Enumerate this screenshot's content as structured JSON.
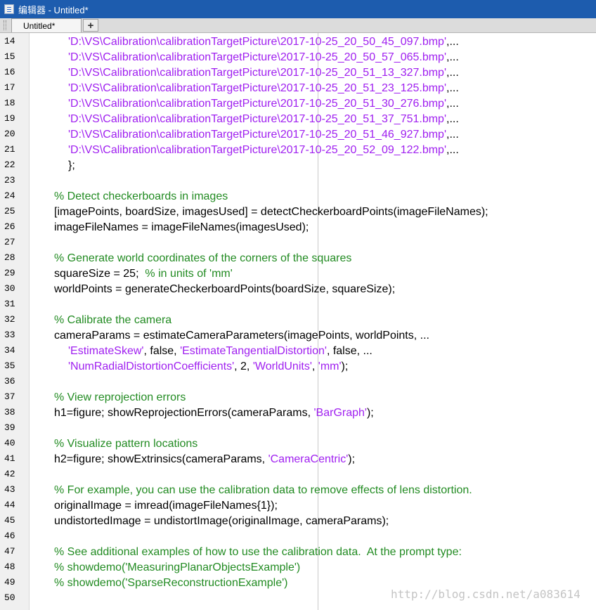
{
  "window": {
    "title": "编辑器 - Untitled*"
  },
  "tabs": [
    {
      "label": "Untitled*"
    }
  ],
  "tabbar": {
    "add_label": "+"
  },
  "editor": {
    "lines": [
      {
        "n": "14",
        "indent": 1,
        "segs": [
          {
            "t": "str",
            "s": "'D:\\VS\\Calibration\\calibrationTargetPicture\\2017-10-25_20_50_45_097.bmp'"
          },
          {
            "t": "",
            "s": ",..."
          }
        ]
      },
      {
        "n": "15",
        "indent": 1,
        "segs": [
          {
            "t": "str",
            "s": "'D:\\VS\\Calibration\\calibrationTargetPicture\\2017-10-25_20_50_57_065.bmp'"
          },
          {
            "t": "",
            "s": ",..."
          }
        ]
      },
      {
        "n": "16",
        "indent": 1,
        "segs": [
          {
            "t": "str",
            "s": "'D:\\VS\\Calibration\\calibrationTargetPicture\\2017-10-25_20_51_13_327.bmp'"
          },
          {
            "t": "",
            "s": ",..."
          }
        ]
      },
      {
        "n": "17",
        "indent": 1,
        "segs": [
          {
            "t": "str",
            "s": "'D:\\VS\\Calibration\\calibrationTargetPicture\\2017-10-25_20_51_23_125.bmp'"
          },
          {
            "t": "",
            "s": ",..."
          }
        ]
      },
      {
        "n": "18",
        "indent": 1,
        "segs": [
          {
            "t": "str",
            "s": "'D:\\VS\\Calibration\\calibrationTargetPicture\\2017-10-25_20_51_30_276.bmp'"
          },
          {
            "t": "",
            "s": ",..."
          }
        ]
      },
      {
        "n": "19",
        "indent": 1,
        "segs": [
          {
            "t": "str",
            "s": "'D:\\VS\\Calibration\\calibrationTargetPicture\\2017-10-25_20_51_37_751.bmp'"
          },
          {
            "t": "",
            "s": ",..."
          }
        ]
      },
      {
        "n": "20",
        "indent": 1,
        "segs": [
          {
            "t": "str",
            "s": "'D:\\VS\\Calibration\\calibrationTargetPicture\\2017-10-25_20_51_46_927.bmp'"
          },
          {
            "t": "",
            "s": ",..."
          }
        ]
      },
      {
        "n": "21",
        "indent": 1,
        "segs": [
          {
            "t": "str",
            "s": "'D:\\VS\\Calibration\\calibrationTargetPicture\\2017-10-25_20_52_09_122.bmp'"
          },
          {
            "t": "",
            "s": ",..."
          }
        ]
      },
      {
        "n": "22",
        "indent": 1,
        "segs": [
          {
            "t": "",
            "s": "};"
          }
        ]
      },
      {
        "n": "23",
        "indent": 0,
        "segs": []
      },
      {
        "n": "24",
        "indent": 0,
        "segs": [
          {
            "t": "cmt",
            "s": "% Detect checkerboards in images"
          }
        ]
      },
      {
        "n": "25",
        "indent": 0,
        "segs": [
          {
            "t": "",
            "s": "[imagePoints, boardSize, imagesUsed] = detectCheckerboardPoints(imageFileNames);"
          }
        ]
      },
      {
        "n": "26",
        "indent": 0,
        "segs": [
          {
            "t": "",
            "s": "imageFileNames = imageFileNames(imagesUsed);"
          }
        ]
      },
      {
        "n": "27",
        "indent": 0,
        "segs": []
      },
      {
        "n": "28",
        "indent": 0,
        "segs": [
          {
            "t": "cmt",
            "s": "% Generate world coordinates of the corners of the squares"
          }
        ]
      },
      {
        "n": "29",
        "indent": 0,
        "segs": [
          {
            "t": "",
            "s": "squareSize = 25;  "
          },
          {
            "t": "cmt",
            "s": "% in units of 'mm'"
          }
        ]
      },
      {
        "n": "30",
        "indent": 0,
        "segs": [
          {
            "t": "",
            "s": "worldPoints = generateCheckerboardPoints(boardSize, squareSize);"
          }
        ]
      },
      {
        "n": "31",
        "indent": 0,
        "segs": []
      },
      {
        "n": "32",
        "indent": 0,
        "segs": [
          {
            "t": "cmt",
            "s": "% Calibrate the camera"
          }
        ]
      },
      {
        "n": "33",
        "indent": 0,
        "segs": [
          {
            "t": "",
            "s": "cameraParams = estimateCameraParameters(imagePoints, worldPoints, ..."
          }
        ]
      },
      {
        "n": "34",
        "indent": 1,
        "segs": [
          {
            "t": "str",
            "s": "'EstimateSkew'"
          },
          {
            "t": "",
            "s": ", false, "
          },
          {
            "t": "str",
            "s": "'EstimateTangentialDistortion'"
          },
          {
            "t": "",
            "s": ", false, ..."
          }
        ]
      },
      {
        "n": "35",
        "indent": 1,
        "segs": [
          {
            "t": "str",
            "s": "'NumRadialDistortionCoefficients'"
          },
          {
            "t": "",
            "s": ", 2, "
          },
          {
            "t": "str",
            "s": "'WorldUnits'"
          },
          {
            "t": "",
            "s": ", "
          },
          {
            "t": "str",
            "s": "'mm'"
          },
          {
            "t": "",
            "s": ");"
          }
        ]
      },
      {
        "n": "36",
        "indent": 0,
        "segs": []
      },
      {
        "n": "37",
        "indent": 0,
        "segs": [
          {
            "t": "cmt",
            "s": "% View reprojection errors"
          }
        ]
      },
      {
        "n": "38",
        "indent": 0,
        "segs": [
          {
            "t": "",
            "s": "h1=figure; showReprojectionErrors(cameraParams, "
          },
          {
            "t": "str",
            "s": "'BarGraph'"
          },
          {
            "t": "",
            "s": ");"
          }
        ]
      },
      {
        "n": "39",
        "indent": 0,
        "segs": []
      },
      {
        "n": "40",
        "indent": 0,
        "segs": [
          {
            "t": "cmt",
            "s": "% Visualize pattern locations"
          }
        ]
      },
      {
        "n": "41",
        "indent": 0,
        "segs": [
          {
            "t": "",
            "s": "h2=figure; showExtrinsics(cameraParams, "
          },
          {
            "t": "str",
            "s": "'CameraCentric'"
          },
          {
            "t": "",
            "s": ");"
          }
        ]
      },
      {
        "n": "42",
        "indent": 0,
        "segs": []
      },
      {
        "n": "43",
        "indent": 0,
        "segs": [
          {
            "t": "cmt",
            "s": "% For example, you can use the calibration data to remove effects of lens distortion."
          }
        ]
      },
      {
        "n": "44",
        "indent": 0,
        "segs": [
          {
            "t": "",
            "s": "originalImage = imread(imageFileNames{1});"
          }
        ]
      },
      {
        "n": "45",
        "indent": 0,
        "segs": [
          {
            "t": "",
            "s": "undistortedImage = undistortImage(originalImage, cameraParams);"
          }
        ]
      },
      {
        "n": "46",
        "indent": 0,
        "segs": []
      },
      {
        "n": "47",
        "indent": 0,
        "segs": [
          {
            "t": "cmt",
            "s": "% See additional examples of how to use the calibration data.  At the prompt type:"
          }
        ]
      },
      {
        "n": "48",
        "indent": 0,
        "segs": [
          {
            "t": "cmt",
            "s": "% showdemo('MeasuringPlanarObjectsExample')"
          }
        ]
      },
      {
        "n": "49",
        "indent": 0,
        "segs": [
          {
            "t": "cmt",
            "s": "% showdemo('SparseReconstructionExample')"
          }
        ]
      },
      {
        "n": "50",
        "indent": 0,
        "segs": []
      }
    ]
  },
  "watermark": "http://blog.csdn.net/a083614",
  "colors": {
    "string": "#a020f0",
    "comment": "#228b22",
    "title_bar": "#1d5cae"
  },
  "icons": {
    "app": "editor-document-icon"
  }
}
